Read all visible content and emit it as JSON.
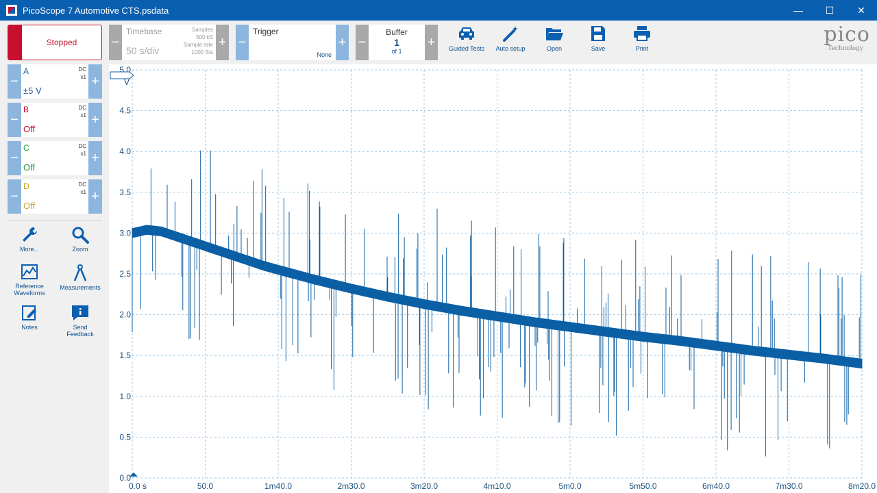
{
  "window": {
    "title": "PicoScope 7 Automotive CTS.psdata",
    "minimize": "—",
    "maximize": "☐",
    "close": "✕"
  },
  "run_button": {
    "label": "Stopped"
  },
  "channels": [
    {
      "name": "A",
      "coupling": "DC",
      "probe": "x1",
      "range": "±5 V",
      "color": "#1a5fa0"
    },
    {
      "name": "B",
      "coupling": "DC",
      "probe": "x1",
      "range": "Off",
      "color": "#c8102e"
    },
    {
      "name": "C",
      "coupling": "DC",
      "probe": "x1",
      "range": "Off",
      "color": "#1e9a3c"
    },
    {
      "name": "D",
      "coupling": "DC",
      "probe": "x1",
      "range": "Off",
      "color": "#c9a227"
    }
  ],
  "tools": {
    "more": "More...",
    "zoom": "Zoom",
    "reference_line1": "Reference",
    "reference_line2": "Waveforms",
    "measurements": "Measurements",
    "notes": "Notes",
    "feedback": "Send Feedback"
  },
  "timebase": {
    "label": "Timebase",
    "value": "50 s/div",
    "samples_label": "Samples",
    "samples_value": "500 kS",
    "rate_label": "Sample rate",
    "rate_value": "1000 S/s"
  },
  "trigger": {
    "label": "Trigger",
    "mode": "None"
  },
  "buffer": {
    "label": "Buffer",
    "value": "1",
    "of": "of 1"
  },
  "toolbar": {
    "guided_tests": "Guided Tests",
    "auto_setup": "Auto setup",
    "open": "Open",
    "save": "Save",
    "print": "Print"
  },
  "logo": {
    "brand": "pico",
    "sub": "Technology"
  },
  "chart_data": {
    "type": "line",
    "ylabel": "V",
    "ylim": [
      0,
      5
    ],
    "yticks": [
      "0.0",
      "0.5",
      "1.0",
      "1.5",
      "2.0",
      "2.5",
      "3.0",
      "3.5",
      "4.0",
      "4.5",
      "5.0"
    ],
    "xticks": [
      "0.0 s",
      "50.0",
      "1m40.0",
      "2m30.0",
      "3m20.0",
      "4m10.0",
      "5m0.0",
      "5m50.0",
      "6m40.0",
      "7m30.0",
      "8m20.0"
    ],
    "xlim_s": [
      0,
      500
    ],
    "series": [
      {
        "name": "A",
        "color": "#0b5fa5",
        "x": [
          0,
          10,
          20,
          30,
          40,
          50,
          60,
          70,
          80,
          90,
          100,
          125,
          150,
          175,
          200,
          225,
          250,
          275,
          300,
          325,
          350,
          375,
          400,
          425,
          450,
          475,
          500
        ],
        "y": [
          3.0,
          3.04,
          3.02,
          2.96,
          2.9,
          2.84,
          2.78,
          2.72,
          2.66,
          2.6,
          2.55,
          2.43,
          2.32,
          2.22,
          2.13,
          2.05,
          1.98,
          1.91,
          1.85,
          1.79,
          1.73,
          1.68,
          1.62,
          1.56,
          1.51,
          1.46,
          1.4
        ]
      }
    ]
  }
}
